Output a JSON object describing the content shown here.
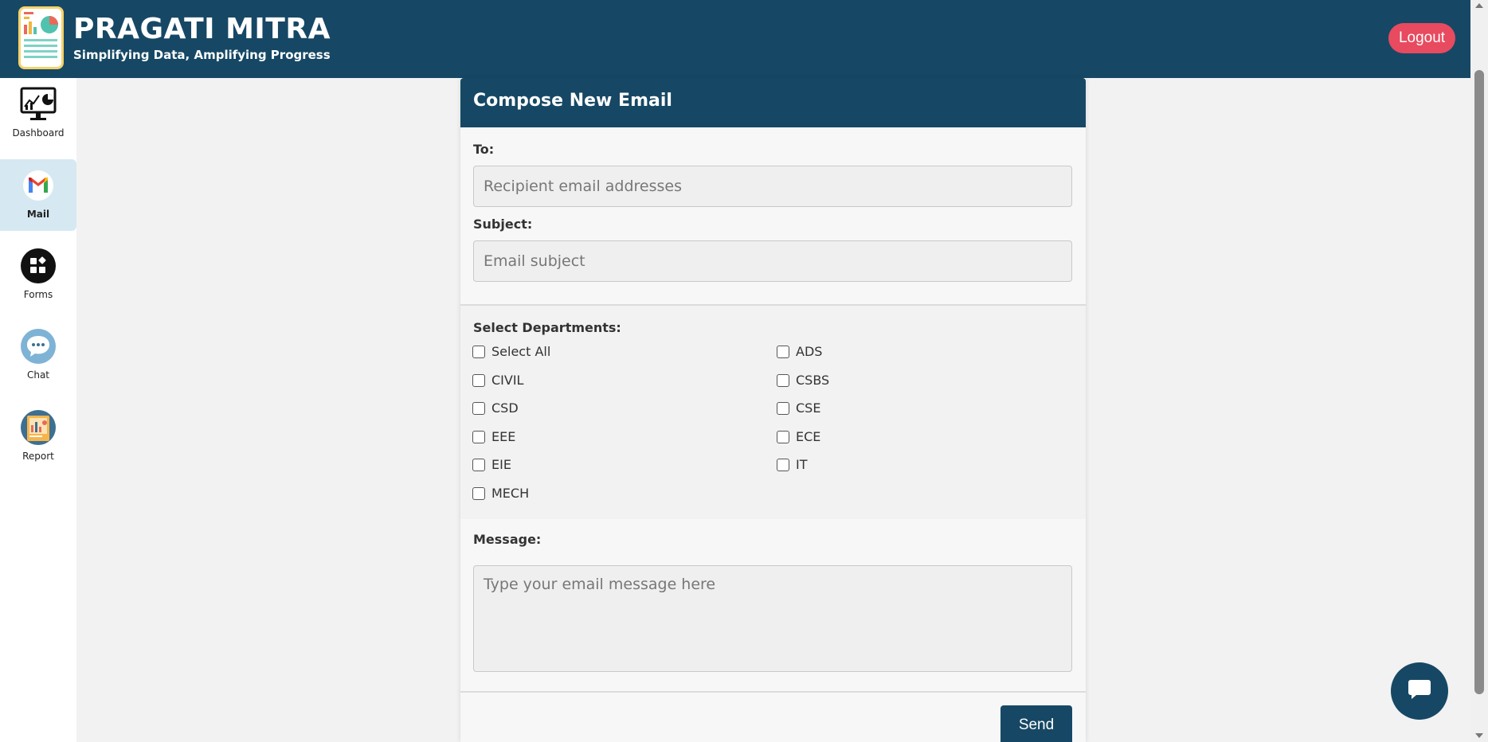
{
  "header": {
    "title": "PRAGATI MITRA",
    "subtitle": "Simplifying Data, Amplifying Progress",
    "logout_label": "Logout"
  },
  "sidebar": {
    "items": [
      {
        "label": "Dashboard",
        "icon": "dashboard-icon"
      },
      {
        "label": "Mail",
        "icon": "gmail-icon",
        "active": true
      },
      {
        "label": "Forms",
        "icon": "forms-icon"
      },
      {
        "label": "Chat",
        "icon": "chat-icon"
      },
      {
        "label": "Report",
        "icon": "report-icon"
      }
    ]
  },
  "compose": {
    "title": "Compose New Email",
    "to_label": "To:",
    "to_placeholder": "Recipient email addresses",
    "subject_label": "Subject:",
    "subject_placeholder": "Email subject",
    "departments_label": "Select Departments:",
    "departments": [
      "Select All",
      "ADS",
      "CIVIL",
      "CSBS",
      "CSD",
      "CSE",
      "EEE",
      "ECE",
      "EIE",
      "IT",
      "MECH"
    ],
    "message_label": "Message:",
    "message_placeholder": "Type your email message here",
    "send_label": "Send"
  },
  "colors": {
    "primary": "#164865",
    "logout": "#e84a5f",
    "active_nav": "#d6e9f2",
    "background": "#f2f2f2"
  }
}
